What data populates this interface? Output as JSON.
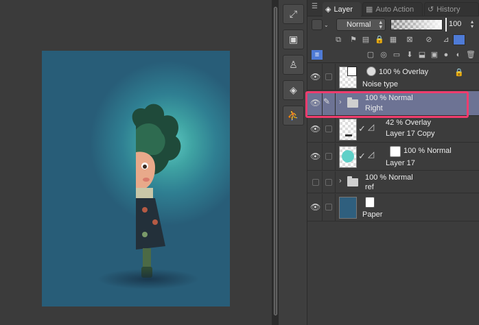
{
  "tabs": [
    {
      "label": "Layer",
      "icon": "layers-icon",
      "active": true
    },
    {
      "label": "Auto Action",
      "icon": "film-icon",
      "active": false
    },
    {
      "label": "History",
      "icon": "history-icon",
      "active": false
    }
  ],
  "blend_mode": {
    "selected": "Normal"
  },
  "opacity": {
    "value": "100",
    "level": 1.0
  },
  "tool_buttons": [
    {
      "icon": "navigator-icon"
    },
    {
      "icon": "sub-view-icon"
    },
    {
      "icon": "pose-icon"
    },
    {
      "icon": "material-icon"
    },
    {
      "icon": "figure-icon"
    }
  ],
  "layers": [
    {
      "mode": "100 % Overlay",
      "name": "Noise type",
      "type": "raster",
      "locked": true,
      "visible": true
    },
    {
      "mode": "100 % Normal",
      "name": "Right",
      "type": "folder",
      "selected": true,
      "visible": true,
      "editing": true
    },
    {
      "mode": "42 % Overlay",
      "name": "Layer 17 Copy",
      "type": "raster",
      "clipped": true,
      "visible": true
    },
    {
      "mode": "100 % Normal",
      "name": "Layer 17",
      "type": "raster",
      "clipped": true,
      "visible": true
    },
    {
      "mode": "100 % Normal",
      "name": "ref",
      "type": "folder",
      "visible": false
    },
    {
      "mode": "",
      "name": "Paper",
      "type": "paper",
      "visible": true,
      "color": "#2f5f7e"
    }
  ],
  "colors": {
    "accent_highlight": "#f23c6e",
    "selected_row": "#6d7394",
    "paper": "#2f5f7e"
  }
}
